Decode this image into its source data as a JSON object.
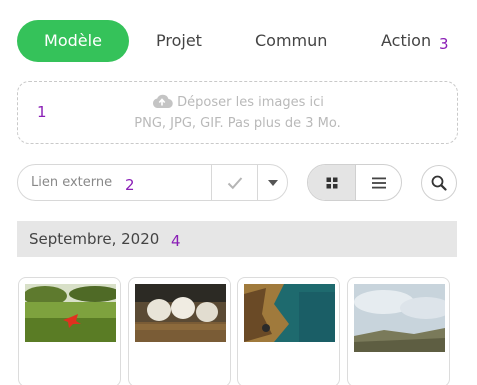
{
  "tabs": [
    {
      "label": "Modèle",
      "active": true
    },
    {
      "label": "Projet",
      "active": false
    },
    {
      "label": "Commun",
      "active": false
    },
    {
      "label": "Action",
      "active": false
    }
  ],
  "markers": {
    "m1": "1",
    "m2": "2",
    "m3": "3",
    "m4": "4"
  },
  "dropzone": {
    "icon": "cloud-upload-icon",
    "line1": "Déposer les images ici",
    "line2": "PNG, JPG, GIF. Pas plus de 3 Mo."
  },
  "link": {
    "placeholder": "Lien externe",
    "value": ""
  },
  "month": {
    "label": "Septembre, 2020"
  },
  "thumbnails": [
    {
      "icon": "meadow-photo"
    },
    {
      "icon": "pumpkins-photo"
    },
    {
      "icon": "coast-aerial-photo"
    },
    {
      "icon": "cloudy-landscape-photo"
    }
  ],
  "colors": {
    "accent": "#35c25a",
    "marker": "#8a1fb6"
  }
}
